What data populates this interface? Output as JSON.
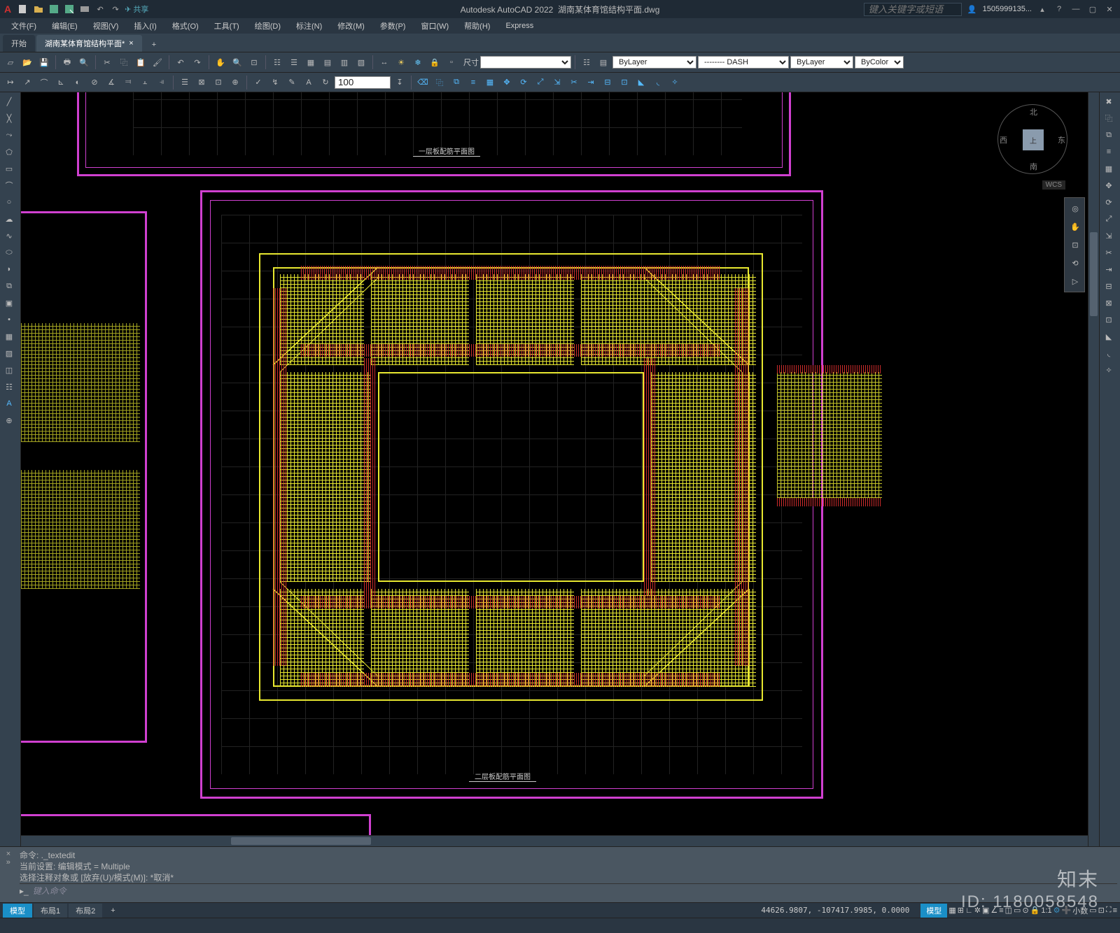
{
  "app": {
    "title": "Autodesk AutoCAD 2022",
    "filename": "湖南某体育馆结构平面.dwg"
  },
  "titlebar": {
    "share": "共享",
    "search_placeholder": "键入关键字或短语",
    "user": "1505999135...",
    "logo": "A"
  },
  "menu": [
    "文件(F)",
    "编辑(E)",
    "视图(V)",
    "插入(I)",
    "格式(O)",
    "工具(T)",
    "绘图(D)",
    "标注(N)",
    "修改(M)",
    "参数(P)",
    "窗口(W)",
    "帮助(H)",
    "Express"
  ],
  "filetabs": {
    "start": "开始",
    "doc": "湖南某体育馆结构平面*"
  },
  "toolbar1": {
    "dim_label": "尺寸",
    "num_input": "100",
    "layer_combo": "ByLayer",
    "linetype_combo": "-------- DASH",
    "lineweight_combo": "ByLayer",
    "color_combo": "ByColor"
  },
  "viewcube": {
    "face": "上",
    "n": "北",
    "s": "南",
    "e": "东",
    "w": "西",
    "wcs": "WCS"
  },
  "drawing": {
    "title_top": "一层板配筋平面图",
    "title_main": "二层板配筋平面图"
  },
  "cmd": {
    "line1": "命令: ._textedit",
    "line2": "当前设置: 编辑模式 = Multiple",
    "line3": "选择注释对象或 [放弃(U)/模式(M)]: *取消*",
    "prompt": "键入命令"
  },
  "layout": {
    "tabs": [
      "模型",
      "布局1",
      "布局2"
    ],
    "plus": "+"
  },
  "status": {
    "coords": "44626.9807, -107417.9985, 0.0000",
    "model": "模型",
    "scale": "1:1",
    "dec": "小数"
  },
  "watermark": {
    "brand": "知末",
    "id_label": "ID:",
    "id": "1180058548"
  }
}
